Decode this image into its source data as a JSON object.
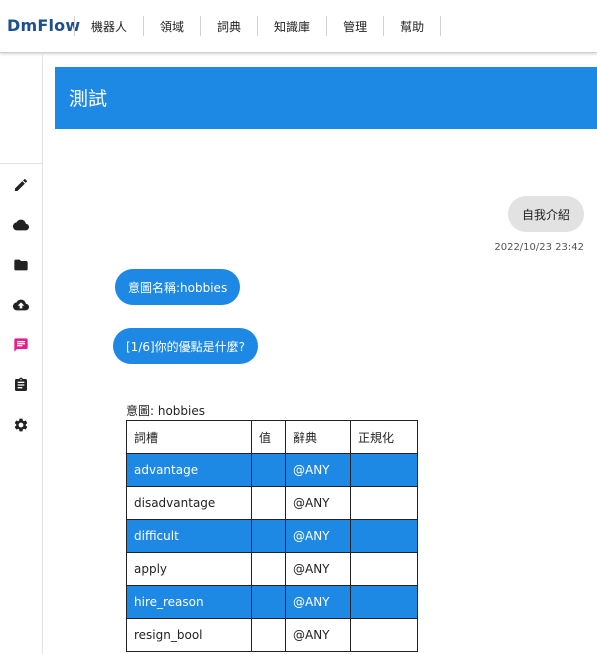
{
  "app": {
    "brand": "DmFlow"
  },
  "nav": {
    "items": [
      "機器人",
      "領域",
      "詞典",
      "知識庫",
      "管理",
      "幫助"
    ]
  },
  "sidebar": {
    "icons": [
      "edit-icon",
      "cloud-icon",
      "folder-icon",
      "cloud-upload-icon",
      "chat-icon",
      "clipboard-icon",
      "gear-icon"
    ],
    "active": "chat-icon"
  },
  "header": {
    "title": "測試"
  },
  "chat": {
    "user_message": "自我介紹",
    "timestamp": "2022/10/23 23:42",
    "bot_messages": [
      "意圖名稱:hobbies",
      "[1/6]你的優點是什麼?"
    ]
  },
  "intent_table": {
    "label": "意圖: hobbies",
    "columns": [
      "詞槽",
      "值",
      "辭典",
      "正規化"
    ],
    "rows": [
      [
        "advantage",
        "",
        "@ANY",
        ""
      ],
      [
        "disadvantage",
        "",
        "@ANY",
        ""
      ],
      [
        "difficult",
        "",
        "@ANY",
        ""
      ],
      [
        "apply",
        "",
        "@ANY",
        ""
      ],
      [
        "hire_reason",
        "",
        "@ANY",
        ""
      ],
      [
        "resign_bool",
        "",
        "@ANY",
        ""
      ]
    ]
  },
  "colors": {
    "accent": "#1e88e5",
    "brand": "#1e4f8f",
    "active_icon": "#e91e8c",
    "user_bubble": "#e2e2e2"
  }
}
